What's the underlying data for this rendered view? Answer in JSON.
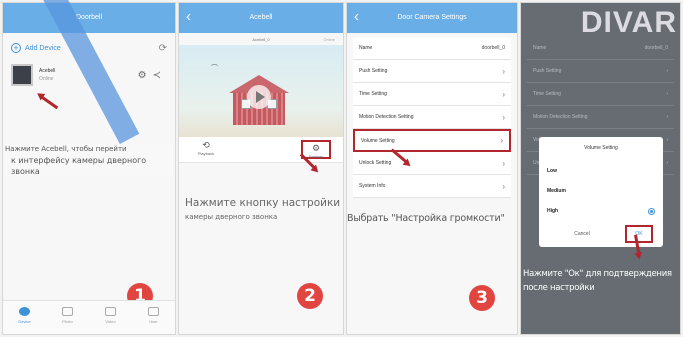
{
  "panel1": {
    "header_title": "Doorbell",
    "add_device": "Add Device",
    "device_name": "Acebell",
    "device_status": "Online",
    "tabs": [
      "Device",
      "Photo",
      "Video",
      "User"
    ],
    "caption_line1": "Нажмите Acebell, чтобы перейти",
    "caption_line2": "к интерфейсу камеры дверного звонка",
    "step": "1"
  },
  "panel2": {
    "header_title": "Acebell",
    "device_title": "Acebell_0",
    "header_right": "Online",
    "action_playback": "Playback",
    "action_settings": "Settings",
    "caption_line1": "Нажмите кнопку настройки",
    "caption_line2": "камеры дверного звонка",
    "step": "2"
  },
  "panel3": {
    "header_title": "Door Camera Settings",
    "name_label": "Name",
    "name_value": "doorbell_0",
    "items": [
      "Push Setting",
      "Time Setting",
      "Motion Detection Setting",
      "Volume Setting",
      "Unlock Setting",
      "System Info"
    ],
    "caption": "Выбрать \"Настройка громкости\"",
    "step": "3"
  },
  "panel4": {
    "brand": "DIVAR",
    "bg_name_label": "Name",
    "bg_name_value": "doorbell_0",
    "bg_items": [
      "Push Setting",
      "Time Setting",
      "Motion Detection Setting",
      "Volume Setting",
      "Unlock Setting"
    ],
    "dialog_title": "Volume Setting",
    "options": [
      "Low",
      "Medium",
      "High"
    ],
    "selected_option": "High",
    "cancel": "Cancel",
    "ok": "OK",
    "caption_line1": "Нажмите \"Ок\" для подтверждения",
    "caption_line2": "после настройки"
  },
  "colors": {
    "header": "#6aaee7",
    "accent": "#3f92d8",
    "highlight": "#b3262d",
    "badge": "#e0463f"
  }
}
